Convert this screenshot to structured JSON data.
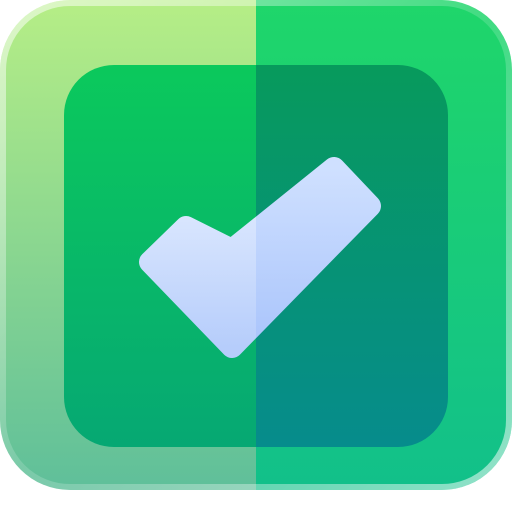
{
  "icon": {
    "name": "checkmark-app-icon",
    "colors": {
      "outer_tile_left_top": "#b6ee86",
      "outer_tile_left_bottom": "#5fbf9a",
      "outer_tile_right_top": "#1fd66a",
      "outer_tile_right_bottom": "#12c08a",
      "inner_square_left_top": "#0bc95c",
      "inner_square_left_bottom": "#06a873",
      "inner_square_right_top": "#079a5c",
      "inner_square_right_bottom": "#068c8c",
      "check_left_top": "#e6efff",
      "check_left_bottom": "#b6cdfb",
      "check_right_top": "#cfe0ff",
      "check_right_bottom": "#a9c4fb"
    }
  }
}
